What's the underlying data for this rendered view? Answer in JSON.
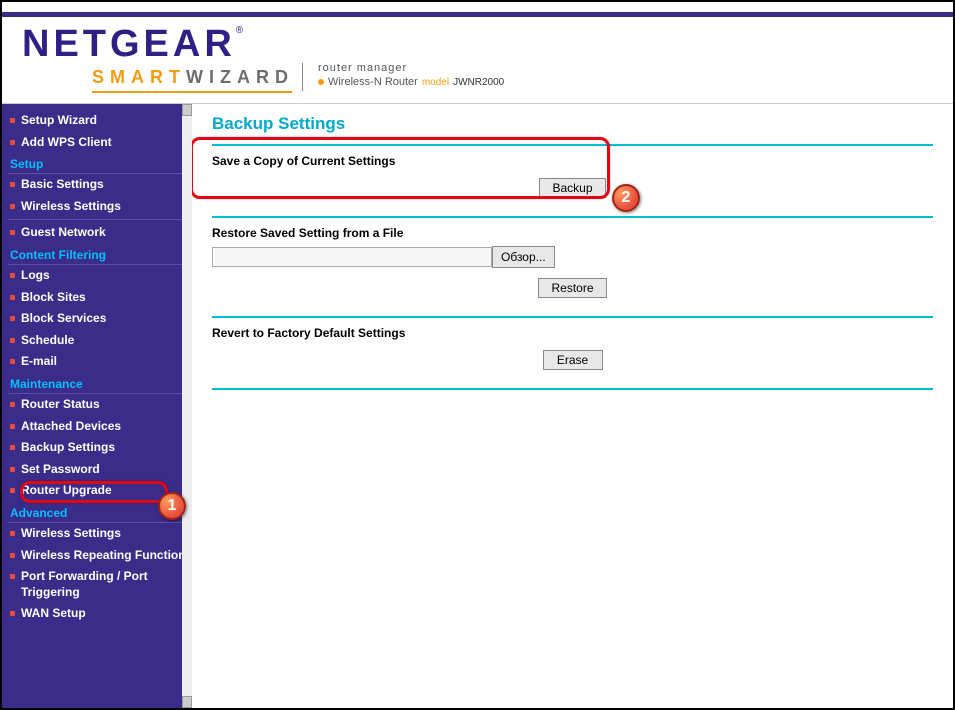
{
  "brand": {
    "name": "NETGEAR",
    "subbrand_smart": "SMART",
    "subbrand_wizard": "WIZARD",
    "header_title": "router manager",
    "router_type": "Wireless-N Router",
    "model_label": "model",
    "model_name": "JWNR2000"
  },
  "sidebar": {
    "setup_wizard": "Setup Wizard",
    "add_wps_client": "Add WPS Client",
    "heading_setup": "Setup",
    "basic_settings": "Basic Settings",
    "wireless_settings": "Wireless Settings",
    "guest_network": "Guest Network",
    "heading_content_filtering": "Content Filtering",
    "logs": "Logs",
    "block_sites": "Block Sites",
    "block_services": "Block Services",
    "schedule": "Schedule",
    "email": "E-mail",
    "heading_maintenance": "Maintenance",
    "router_status": "Router Status",
    "attached_devices": "Attached Devices",
    "backup_settings": "Backup Settings",
    "set_password": "Set Password",
    "router_upgrade": "Router Upgrade",
    "heading_advanced": "Advanced",
    "adv_wireless_settings": "Wireless Settings",
    "wireless_repeating": "Wireless Repeating Function",
    "port_forwarding": "Port Forwarding / Port Triggering",
    "wan_setup": "WAN Setup"
  },
  "content": {
    "page_title": "Backup Settings",
    "save_copy_title": "Save a Copy of Current Settings",
    "backup_btn": "Backup",
    "restore_title": "Restore Saved Setting from a File",
    "browse_btn": "Обзор...",
    "restore_btn": "Restore",
    "revert_title": "Revert to Factory Default Settings",
    "erase_btn": "Erase"
  },
  "callouts": {
    "one": "1",
    "two": "2"
  }
}
